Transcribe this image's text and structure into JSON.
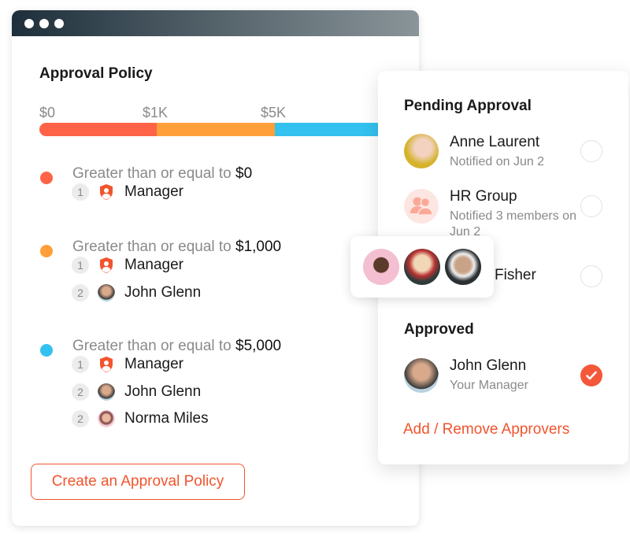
{
  "colors": {
    "accent": "#f2542d",
    "tier1": "#ff6347",
    "tier2": "#ff9f3a",
    "tier3": "#33c1ef",
    "approved": "#f4583a"
  },
  "policy": {
    "title": "Approval Policy",
    "scale": [
      "$0",
      "$1K",
      "$5K"
    ],
    "tiers": [
      {
        "prefix": "Greater than or equal to ",
        "amount": "$0",
        "steps": [
          {
            "n": "1",
            "label": "Manager",
            "icon": "shield-user-icon"
          }
        ]
      },
      {
        "prefix": "Greater than or equal to ",
        "amount": "$1,000",
        "steps": [
          {
            "n": "1",
            "label": "Manager",
            "icon": "shield-user-icon"
          },
          {
            "n": "2",
            "label": "John Glenn",
            "icon": "avatar"
          }
        ]
      },
      {
        "prefix": "Greater than or equal to ",
        "amount": "$5,000",
        "steps": [
          {
            "n": "1",
            "label": "Manager",
            "icon": "shield-user-icon"
          },
          {
            "n": "2",
            "label": "John Glenn",
            "icon": "avatar"
          },
          {
            "n": "2",
            "label": "Norma Miles",
            "icon": "avatar"
          }
        ]
      }
    ],
    "create_button": "Create an Approval Policy"
  },
  "approvals": {
    "pending_title": "Pending Approval",
    "pending": [
      {
        "name": "Anne Laurent",
        "sub": "Notified on Jun 2"
      },
      {
        "name": "HR Group",
        "sub": "Notified 3 members on Jun 2"
      },
      {
        "name": "Fisher",
        "sub": ""
      }
    ],
    "approved_title": "Approved",
    "approved": [
      {
        "name": "John Glenn",
        "sub": "Your Manager"
      }
    ],
    "add_remove": "Add / Remove Approvers"
  }
}
